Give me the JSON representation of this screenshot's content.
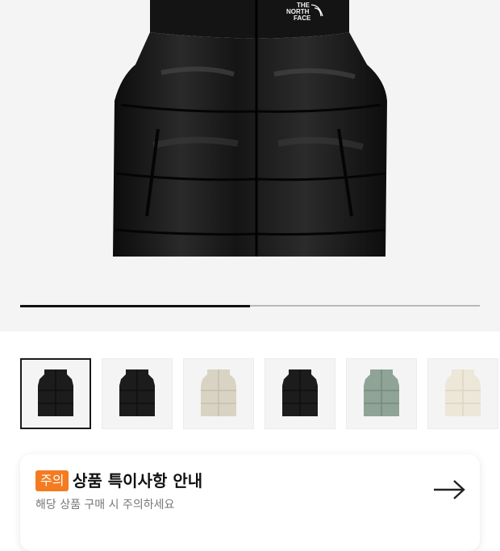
{
  "product": {
    "logo_lines": [
      "THE",
      "NORTH",
      "FACE"
    ],
    "image_name": "black-nuptse-down-vest"
  },
  "gallery": {
    "current_index": 1,
    "total": 6,
    "progress": 0.5,
    "thumbnails": [
      {
        "name": "thumb-vest-black-1",
        "color": "#1c1c1c",
        "accent": "#0e0e0e",
        "active": true
      },
      {
        "name": "thumb-vest-black-2",
        "color": "#1c1c1c",
        "accent": "#0e0e0e",
        "active": false
      },
      {
        "name": "thumb-vest-beige",
        "color": "#d9d3c4",
        "accent": "#c6bfae",
        "active": false
      },
      {
        "name": "thumb-vest-black-3",
        "color": "#1c1c1c",
        "accent": "#0e0e0e",
        "active": false
      },
      {
        "name": "thumb-vest-sage",
        "color": "#8fa396",
        "accent": "#768b7c",
        "active": false
      },
      {
        "name": "thumb-vest-cream",
        "color": "#ece7d9",
        "accent": "#dcd5c3",
        "active": false
      }
    ]
  },
  "notice": {
    "badge": "주의",
    "title": "상품 특이사항 안내",
    "subtitle": "해당 상품 구매 시 주의하세요",
    "arrow_icon": "arrow-right-icon"
  },
  "colors": {
    "accent": "#f47b20",
    "hero_bg": "#f4f4f4",
    "progress_fill": "#111111",
    "progress_track": "#b8b8b8"
  }
}
